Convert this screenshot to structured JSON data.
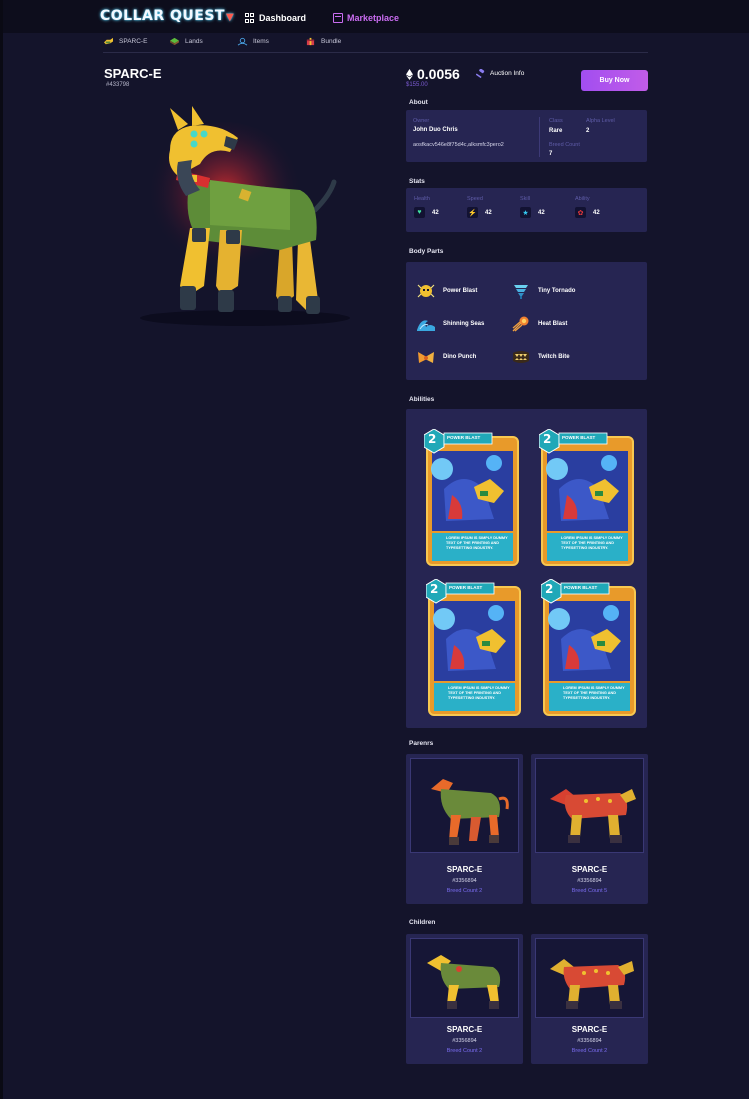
{
  "brand": {
    "logo_text": "COLLAR QUEST"
  },
  "nav": {
    "dashboard": "Dashboard",
    "marketplace": "Marketplace"
  },
  "subnav": [
    {
      "label": "SPARC-E",
      "icon": "dog-icon"
    },
    {
      "label": "Lands",
      "icon": "land-icon"
    },
    {
      "label": "Items",
      "icon": "items-icon"
    },
    {
      "label": "Bundle",
      "icon": "bundle-icon"
    }
  ],
  "item": {
    "name": "SPARC-E",
    "id": "#433798"
  },
  "price": {
    "eth": "0.0056",
    "usd": "$155.00",
    "auction_label": "Auction Info",
    "buy_label": "Buy Now"
  },
  "about": {
    "section": "About",
    "owner_label": "Owner",
    "owner": "John Duo Chris",
    "wallet": "aosfkacv546e8f75d4c,alksmfc3pero2",
    "class_label": "Class",
    "class": "Rare",
    "alpha_label": "Alpha Level",
    "alpha": "2",
    "breed_label": "Breed Count",
    "breed": "7"
  },
  "stats": {
    "section": "Stats",
    "items": [
      {
        "label": "Health",
        "value": "42",
        "icon": "heart-icon",
        "color": "#3fe0a0"
      },
      {
        "label": "Speed",
        "value": "42",
        "icon": "lightning-icon",
        "color": "#f0a020"
      },
      {
        "label": "Skill",
        "value": "42",
        "icon": "star-icon",
        "color": "#34c8f0"
      },
      {
        "label": "Ability",
        "value": "42",
        "icon": "bug-icon",
        "color": "#e8383c"
      }
    ]
  },
  "body_parts": {
    "section": "Body Parts",
    "items": [
      {
        "label": "Power Blast",
        "icon": "power-blast-icon"
      },
      {
        "label": "Tiny Tornado",
        "icon": "tornado-icon"
      },
      {
        "label": "Shinning Seas",
        "icon": "wave-icon"
      },
      {
        "label": "Heat Blast",
        "icon": "fireball-icon"
      },
      {
        "label": "Dino Punch",
        "icon": "dino-punch-icon"
      },
      {
        "label": "Twitch Bite",
        "icon": "bite-icon"
      }
    ]
  },
  "abilities": {
    "section": "Abilities",
    "cards": [
      {
        "cost": "2",
        "title": "POWER BLAST",
        "text": "LOREM IPSUM IS SIMPLY DUMMY TEXT OF THE PRINTING AND TYPESETTING INDUSTRY."
      },
      {
        "cost": "2",
        "title": "POWER BLAST",
        "text": "LOREM IPSUM IS SIMPLY DUMMY TEXT OF THE PRINTING AND TYPESETTING INDUSTRY."
      },
      {
        "cost": "2",
        "title": "POWER BLAST",
        "text": "LOREM IPSUM IS SIMPLY DUMMY TEXT OF THE PRINTING AND TYPESETTING INDUSTRY."
      },
      {
        "cost": "2",
        "title": "POWER BLAST",
        "text": "LOREM IPSUM IS SIMPLY DUMMY TEXT OF THE PRINTING AND TYPESETTING INDUSTRY."
      }
    ]
  },
  "parents": {
    "section": "Parenrs",
    "items": [
      {
        "name": "SPARC-E",
        "id": "#3356894",
        "breed": "Breed Count 2"
      },
      {
        "name": "SPARC-E",
        "id": "#3356894",
        "breed": "Breed Count 5"
      }
    ]
  },
  "children": {
    "section": "Children",
    "items": [
      {
        "name": "SPARC-E",
        "id": "#3356894",
        "breed": "Breed Count 2"
      },
      {
        "name": "SPARC-E",
        "id": "#3356894",
        "breed": "Breed Count 2"
      }
    ]
  },
  "colors": {
    "background": "#14142b",
    "panel": "#262552",
    "accent": "#a24ef0",
    "marketplace": "#c96cf0",
    "link": "#7a6cf0"
  }
}
